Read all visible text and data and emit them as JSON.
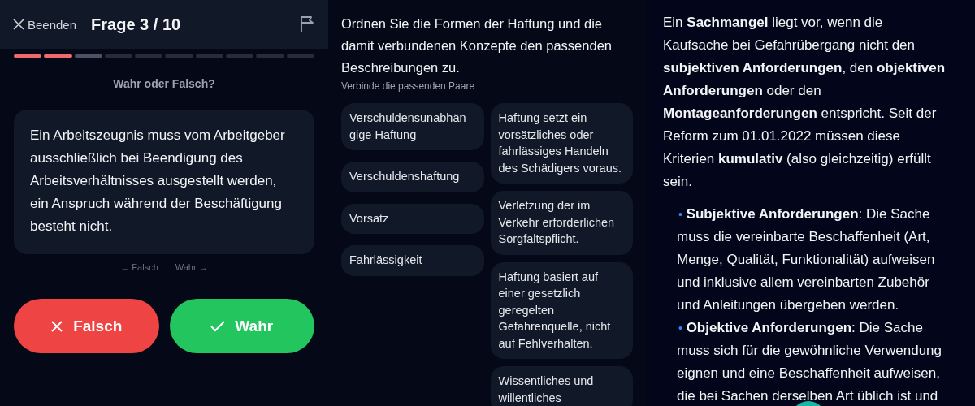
{
  "quiz_panel": {
    "close_label": "Beenden",
    "title": "Frage 3 / 10",
    "progress": [
      {
        "kind": "done"
      },
      {
        "kind": "done"
      },
      {
        "kind": "current"
      },
      {
        "kind": "pending"
      },
      {
        "kind": "pending"
      },
      {
        "kind": "pending"
      },
      {
        "kind": "pending"
      },
      {
        "kind": "pending"
      },
      {
        "kind": "pending"
      },
      {
        "kind": "pending"
      }
    ],
    "prompt": "Wahr oder Falsch?",
    "statement": "Ein Arbeitszeugnis muss vom Arbeitgeber ausschließlich bei Beendigung des Arbeitsverhältnisses ausgestellt werden, ein Anspruch während der Beschäftigung besteht nicht.",
    "swipe_hints": [
      "← Falsch",
      "Wahr →"
    ],
    "buttons": [
      {
        "kind": "false",
        "label": "Falsch"
      },
      {
        "kind": "true",
        "label": "Wahr"
      }
    ]
  },
  "matching_panel": {
    "question": "Ordnen Sie die Formen der Haftung und die damit verbundenen Konzepte den passenden Beschreibungen zu.",
    "instruction": "Verbinde die passenden Paare",
    "terms": [
      "Verschuldensunabhän gige Haftung",
      "Verschuldenshaftung",
      "Vorsatz",
      "Fahrlässigkeit"
    ],
    "descriptions": [
      "Haftung setzt ein vorsätzliches oder fahrlässiges Handeln des Schädigers voraus.",
      "Verletzung der im Verkehr erforderlichen Sorgfaltspflicht.",
      "Haftung basiert auf einer gesetzlich geregelten Gefahrenquelle, nicht auf Fehlverhalten.",
      "Wissentliches und willentliches"
    ]
  },
  "explanation_panel": {
    "paragraph": "Ein **Sachmangel** liegt vor, wenn die Kaufsache bei Gefahrübergang nicht den **subjektiven Anforderungen**, den **objektiven Anforderungen** oder den **Montageanforderungen** entspricht. Seit der Reform zum 01.01.2022 müssen diese Kriterien **kumulativ** (also gleichzeitig) erfüllt sein.",
    "bullets": [
      {
        "marker": "•",
        "text": "**Subjektive Anforderungen**: Die Sache muss die vereinbarte Beschaffenheit (Art, Menge, Qualität, Funktionalität) aufweisen und inklusive allem vereinbarten Zubehör und Anleitungen übergeben werden."
      },
      {
        "marker": "•",
        "text": "**Objektive Anforderungen**: Die Sache muss sich für die gewöhnliche Verwendung eignen und eine Beschaffenheit aufweisen, die bei Sachen derselben Art üblich ist und"
      }
    ]
  }
}
